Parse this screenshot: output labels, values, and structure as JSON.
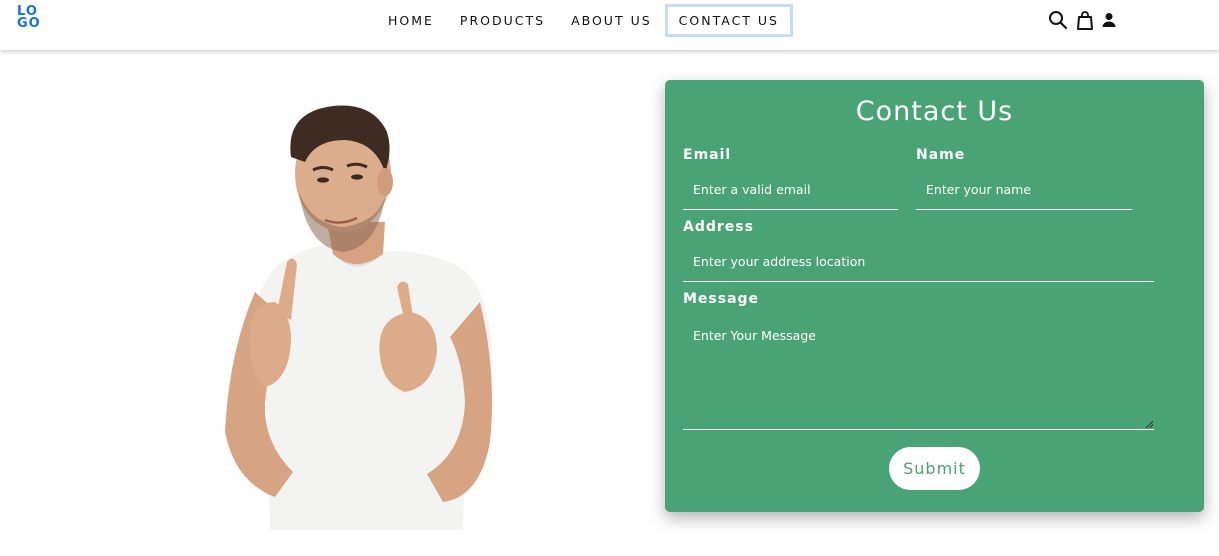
{
  "header": {
    "logo": {
      "line1": "LO",
      "line2": "GO"
    },
    "nav": [
      {
        "label": "HOME"
      },
      {
        "label": "PRODUCTS"
      },
      {
        "label": "ABOUT US"
      },
      {
        "label": "CONTACT US",
        "active": true
      }
    ],
    "icons": [
      "search-icon",
      "shopping-bag-icon",
      "user-icon"
    ]
  },
  "contact": {
    "title": "Contact Us",
    "email": {
      "label": "Email",
      "placeholder": "Enter a valid email"
    },
    "name": {
      "label": "Name",
      "placeholder": "Enter your name"
    },
    "address": {
      "label": "Address",
      "placeholder": "Enter your address location"
    },
    "message": {
      "label": "Message",
      "placeholder": "Enter Your Message"
    },
    "submit_label": "Submit"
  },
  "colors": {
    "card_bg": "#4aa374",
    "logo": "#1b6fd6",
    "active_nav_border": "#c7dcf5"
  }
}
